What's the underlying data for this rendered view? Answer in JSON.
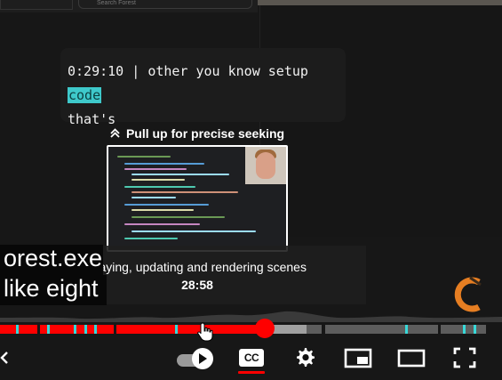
{
  "search": {
    "placeholder": "Search Forest"
  },
  "transcript": {
    "timestamp": "0:29:10",
    "separator": "|",
    "text_before": "other you know setup",
    "highlight": "code",
    "text_after": "that's"
  },
  "seek_hint": {
    "label": "Pull up for precise seeking",
    "icon": "chevron-double-up-icon"
  },
  "chapter": {
    "title": "Playing, updating and rendering scenes",
    "time": "28:58"
  },
  "captions": {
    "line1": "orest.exe",
    "line2": "like eight"
  },
  "progress": {
    "played_fraction": 0.527,
    "buffered_fraction": 0.611
  },
  "colors": {
    "accent": "#ff0000",
    "highlight": "#3ec9cb",
    "chapter_marker": "#39d8d8",
    "logo_orange": "#e67e22"
  },
  "controls": {
    "previous": "chevron-left-icon",
    "autoplay": "autoplay-toggle-icon",
    "subtitles_label": "CC",
    "settings": "gear-icon",
    "miniplayer": "miniplayer-icon",
    "theater": "theater-mode-icon",
    "fullscreen": "fullscreen-icon"
  }
}
